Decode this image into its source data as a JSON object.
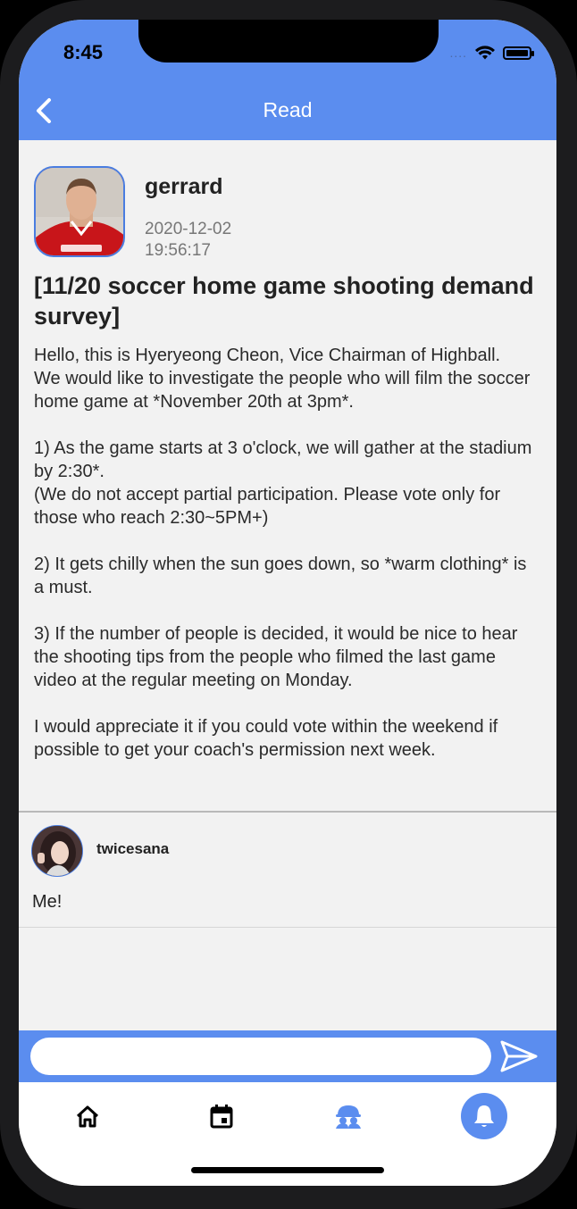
{
  "status_bar": {
    "time": "8:45",
    "signal": "....",
    "icons": [
      "wifi-icon",
      "battery-icon"
    ]
  },
  "header": {
    "title": "Read",
    "back_icon": "chevron-left-icon",
    "color": "#5b8def"
  },
  "post": {
    "author": "gerrard",
    "date": "2020-12-02",
    "time": "19:56:17",
    "title": "[11/20 soccer home game shooting demand survey]",
    "body": "Hello, this is Hyeryeong Cheon, Vice Chairman of Highball.\nWe would like to investigate the people who will film the soccer home game at *November 20th at 3pm*.\n\n1) As the game starts at 3 o'clock, we will gather at the stadium by 2:30*.\n(We do not accept partial participation. Please vote only for those who reach 2:30~5PM+)\n\n2) It gets chilly when the sun goes down, so *warm clothing* is a must.\n\n3) If the number of people is decided, it would be nice to hear the shooting tips from the people who filmed the last game video at the regular meeting on Monday.\n\nI would appreciate it if you could vote within the weekend if possible to get your coach's permission next week."
  },
  "comments": [
    {
      "user": "twicesana",
      "text": "Me!"
    }
  ],
  "comment_input": {
    "placeholder": "",
    "value": "",
    "send_icon": "send-icon"
  },
  "tabbar": {
    "tabs": [
      {
        "icon": "home-icon"
      },
      {
        "icon": "calendar-icon"
      },
      {
        "icon": "community-icon"
      },
      {
        "icon": "bell-icon",
        "active": true
      }
    ]
  }
}
